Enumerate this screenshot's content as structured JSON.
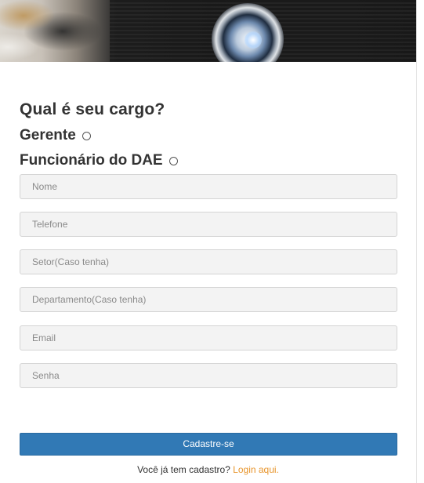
{
  "banner": {
    "image_name": "projector-banner-image"
  },
  "form": {
    "question": "Qual é seu cargo?",
    "options": [
      {
        "label": "Gerente",
        "selected": false
      },
      {
        "label": "Funcionário do DAE",
        "selected": false
      }
    ],
    "fields": [
      {
        "placeholder": "Nome",
        "value": ""
      },
      {
        "placeholder": "Telefone",
        "value": ""
      },
      {
        "placeholder": "Setor(Caso tenha)",
        "value": ""
      },
      {
        "placeholder": "Departamento(Caso tenha)",
        "value": ""
      },
      {
        "placeholder": "Email",
        "value": ""
      },
      {
        "placeholder": "Senha",
        "value": ""
      }
    ],
    "submit_label": "Cadastre-se"
  },
  "footer": {
    "text": "Você já tem cadastro?",
    "link_label": "Login aqui."
  },
  "colors": {
    "button": "#3179b5",
    "link": "#e8962e",
    "field_bg": "#f3f3f3",
    "text": "#333333"
  }
}
